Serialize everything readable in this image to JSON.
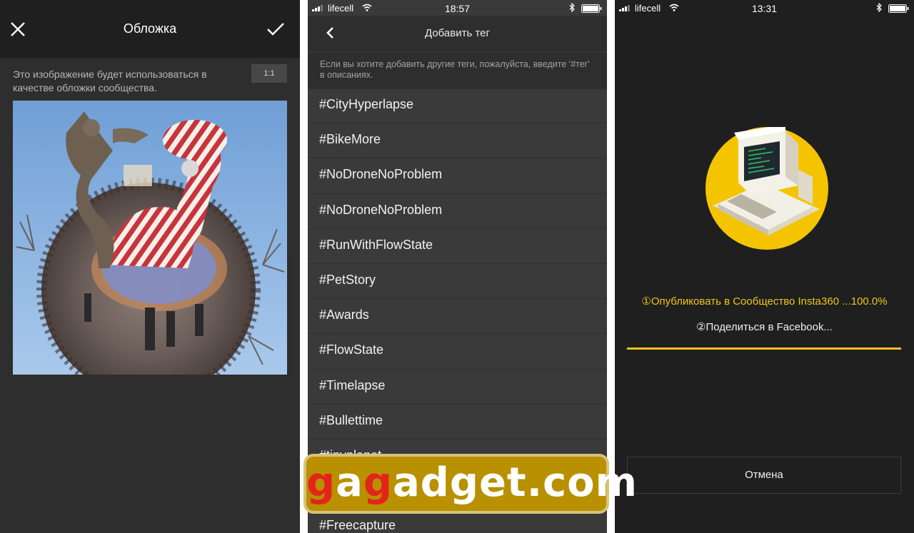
{
  "cover_screen": {
    "title": "Обложка",
    "description": "Это изображение будет использоваться в качестве обложки сообщества.",
    "ratio_label": "1:1",
    "icons": {
      "close": "close-icon",
      "confirm": "checkmark-icon"
    }
  },
  "tag_screen": {
    "status": {
      "carrier": "lifecell",
      "time": "18:57"
    },
    "title": "Добавить тег",
    "hint": "Если вы хотите добавить другие теги, пожалуйста, введите '#тег' в описаниях.",
    "tags": [
      "#CityHyperlapse",
      "#BikeMore",
      "#NoDroneNoProblem",
      "#NoDroneNoProblem",
      "#RunWithFlowState",
      "#PetStory",
      "#Awards",
      "#FlowState",
      "#Timelapse",
      "#Bullettime",
      "#tinyplanet",
      "",
      "#Freecapture"
    ]
  },
  "publish_screen": {
    "status": {
      "carrier": "lifecell",
      "time": "13:31"
    },
    "step1": "①Опубликовать в Сообщество Insta360 ...100.0%",
    "step2": "②Поделиться в Facebook...",
    "progress": 1.0,
    "cancel_label": "Отмена",
    "accent_color": "#f0c419"
  },
  "watermark": {
    "part1": "g",
    "part2": "a",
    "part3": "g",
    "part4": "adget.com"
  }
}
